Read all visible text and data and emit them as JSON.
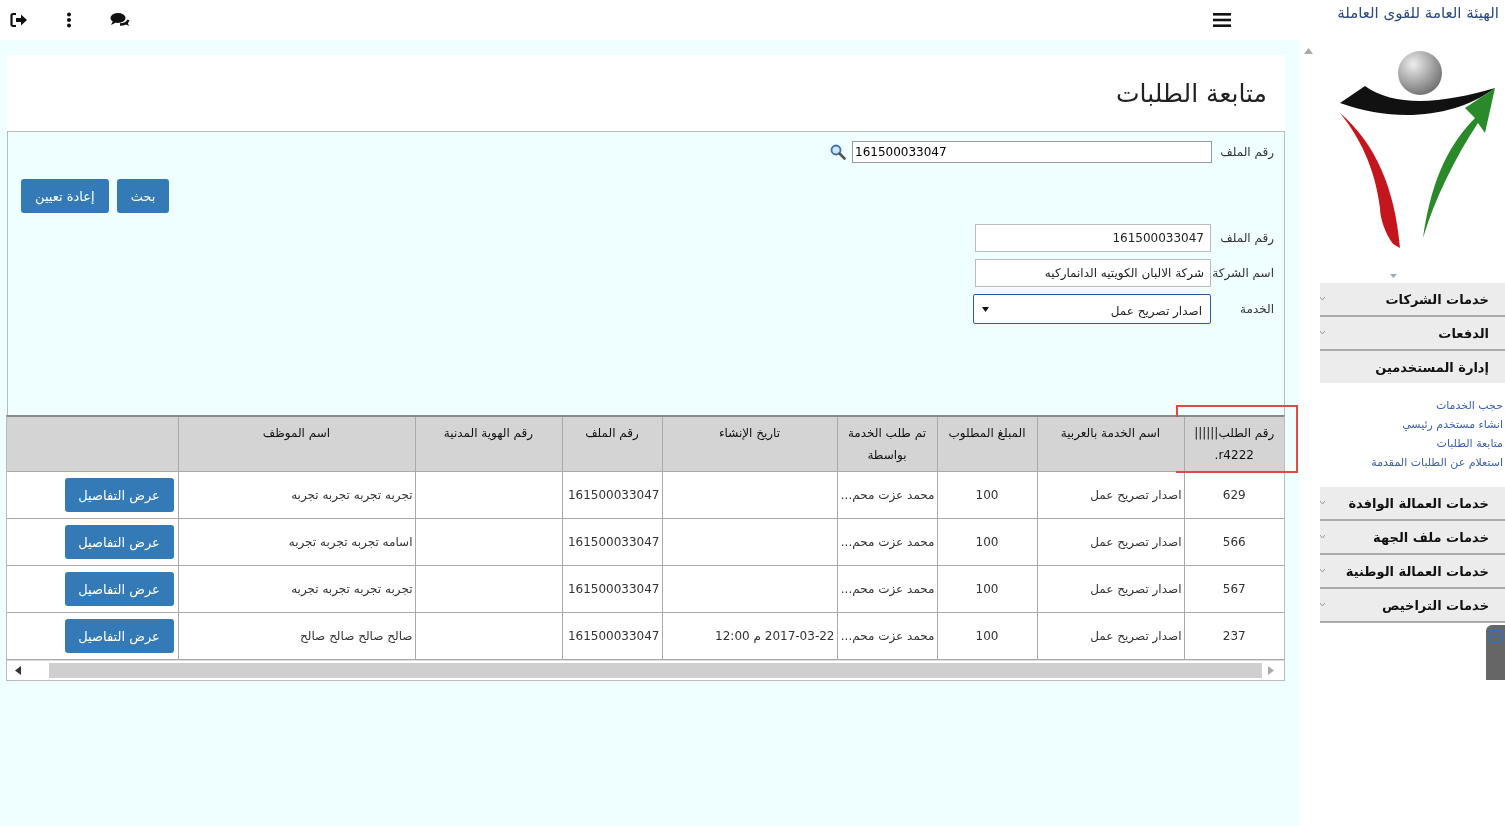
{
  "org_name": "الهيئة العامة للقوى العاملة",
  "sidebar": {
    "items": [
      {
        "label": "خدمات الشركات",
        "expanded": false
      },
      {
        "label": "الدفعات",
        "expanded": false
      },
      {
        "label": "إدارة المستخدمين",
        "expanded": true,
        "children": [
          {
            "label": "حجب الخدمات"
          },
          {
            "label": "انشاء مستخدم رئيسي"
          },
          {
            "label": "متابعة الطلبات"
          },
          {
            "label": "استعلام عن الطلبات المقدمة"
          }
        ]
      },
      {
        "label": "خدمات العمالة الوافدة",
        "expanded": false
      },
      {
        "label": "خدمات ملف الجهة",
        "expanded": false
      },
      {
        "label": "خدمات العمالة الوطنية",
        "expanded": false
      },
      {
        "label": "خدمات التراخيص",
        "expanded": false
      }
    ]
  },
  "page_title": "متابعة الطلبات",
  "quick_search": {
    "label": "رقم الملف",
    "value": "161500033047"
  },
  "buttons": [
    {
      "label": "بحث"
    },
    {
      "label": "إعادة تعيين"
    }
  ],
  "details": [
    {
      "label": "رقم الملف",
      "value": "161500033047",
      "kind": "text"
    },
    {
      "label": "اسم الشركة",
      "value": "شركة الالبان الكويتيه الدانماركيه",
      "kind": "text"
    },
    {
      "label": "الخدمة",
      "value": "اصدار تصريح عمل",
      "kind": "select"
    }
  ],
  "table": {
    "columns": [
      {
        "label": "رقم الطلب|||||| r4222.",
        "highlighted": true
      },
      {
        "label": "اسم الخدمة بالعربية",
        "highlighted": false
      },
      {
        "label": "المبلغ المطلوب",
        "highlighted": false
      },
      {
        "label": "تم طلب الخدمة بواسطة",
        "highlighted": false
      },
      {
        "label": "تاريخ الإنشاء",
        "highlighted": false
      },
      {
        "label": "رقم الملف",
        "highlighted": false
      },
      {
        "label": "رقم الهوية المدنية",
        "highlighted": false
      },
      {
        "label": "اسم الموظف",
        "highlighted": false
      }
    ],
    "rows": [
      {
        "cells": [
          "629",
          "اصدار تصريح عمل",
          "100",
          "محمد عزت محم...",
          "",
          "161500033047",
          "",
          "تجربه تجربه تجربه تجربه"
        ],
        "action": "عرض التفاصيل"
      },
      {
        "cells": [
          "566",
          "اصدار تصريح عمل",
          "100",
          "محمد عزت محم...",
          "",
          "161500033047",
          "",
          "اسامه تجربه تجربه تجربه"
        ],
        "action": "عرض التفاصيل"
      },
      {
        "cells": [
          "567",
          "اصدار تصريح عمل",
          "100",
          "محمد عزت محم...",
          "",
          "161500033047",
          "",
          "تجربه تجربه تجربه تجربه"
        ],
        "action": "عرض التفاصيل"
      },
      {
        "cells": [
          "237",
          "اصدار تصريح عمل",
          "100",
          "محمد عزت محم...",
          "2017-03-22 م 12:00",
          "161500033047",
          "",
          "صالح صالح صالح صالح"
        ],
        "action": "عرض التفاصيل"
      }
    ]
  }
}
